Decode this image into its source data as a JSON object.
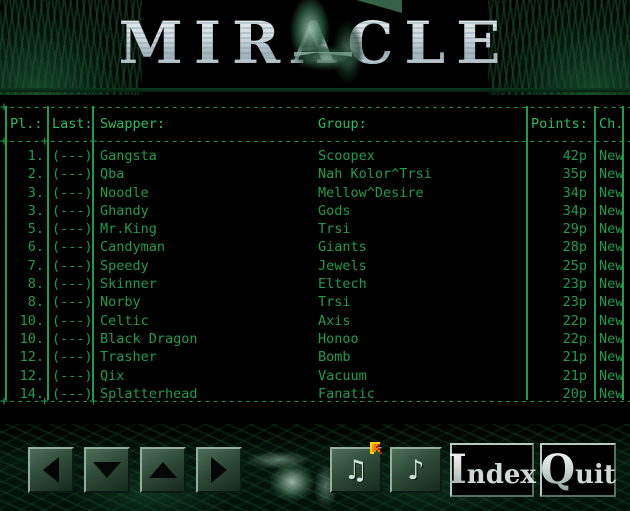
{
  "app": {
    "logo_text": "MIRACLE"
  },
  "table": {
    "headers": {
      "rank": "Pl.:",
      "last": "Last:",
      "swapper": "Swapper:",
      "group": "Group:",
      "points": "Points:",
      "change": "Ch."
    },
    "rule_top": "+--------------------------------------------------------------------------------------------------------------+",
    "rule_mid": "+----+-----+-------------------------------------------------------------------------------+--------+----+",
    "rule_bot": "+----+-----+-------------------------------------------------------------------------------+--------+----+",
    "rows": [
      {
        "rank": "1.",
        "last": "(---)",
        "swapper": "Gangsta",
        "group": "Scoopex",
        "points": "42p",
        "change": "New"
      },
      {
        "rank": "2.",
        "last": "(---)",
        "swapper": "Qba",
        "group": "Nah Kolor^Trsi",
        "points": "35p",
        "change": "New"
      },
      {
        "rank": "3.",
        "last": "(---)",
        "swapper": "Noodle",
        "group": "Mellow^Desire",
        "points": "34p",
        "change": "New"
      },
      {
        "rank": "3.",
        "last": "(---)",
        "swapper": "Ghandy",
        "group": "Gods",
        "points": "34p",
        "change": "New"
      },
      {
        "rank": "5.",
        "last": "(---)",
        "swapper": "Mr.King",
        "group": "Trsi",
        "points": "29p",
        "change": "New"
      },
      {
        "rank": "6.",
        "last": "(---)",
        "swapper": "Candyman",
        "group": "Giants",
        "points": "28p",
        "change": "New"
      },
      {
        "rank": "7.",
        "last": "(---)",
        "swapper": "Speedy",
        "group": "Jewels",
        "points": "25p",
        "change": "New"
      },
      {
        "rank": "8.",
        "last": "(---)",
        "swapper": "Skinner",
        "group": "Eltech",
        "points": "23p",
        "change": "New"
      },
      {
        "rank": "8.",
        "last": "(---)",
        "swapper": "Norby",
        "group": "Trsi",
        "points": "23p",
        "change": "New"
      },
      {
        "rank": "10.",
        "last": "(---)",
        "swapper": "Celtic",
        "group": "Axis",
        "points": "22p",
        "change": "New"
      },
      {
        "rank": "10.",
        "last": "(---)",
        "swapper": "Black Dragon",
        "group": "Honoo",
        "points": "22p",
        "change": "New"
      },
      {
        "rank": "12.",
        "last": "(---)",
        "swapper": "Trasher",
        "group": "Bomb",
        "points": "21p",
        "change": "New"
      },
      {
        "rank": "12.",
        "last": "(---)",
        "swapper": "Qix",
        "group": "Vacuum",
        "points": "21p",
        "change": "New"
      },
      {
        "rank": "14.",
        "last": "(---)",
        "swapper": "Splatterhead",
        "group": "Fanatic",
        "points": "20p",
        "change": "New"
      }
    ]
  },
  "toolbar": {
    "nav_prev_label": "",
    "nav_down_label": "",
    "nav_up_label": "",
    "nav_next_label": "",
    "music_prev_label": "♫",
    "music_next_label": "♪",
    "index_cap": "I",
    "index_rest": "ndex",
    "quit_cap": "Q",
    "quit_rest": "uit"
  },
  "colors": {
    "text_green": "#1f9c4a",
    "header_green": "#2bbd5c",
    "background": "#000000",
    "cursor_yellow": "#ffd200",
    "cursor_orange": "#ff7b00",
    "cursor_red": "#d01b00"
  }
}
